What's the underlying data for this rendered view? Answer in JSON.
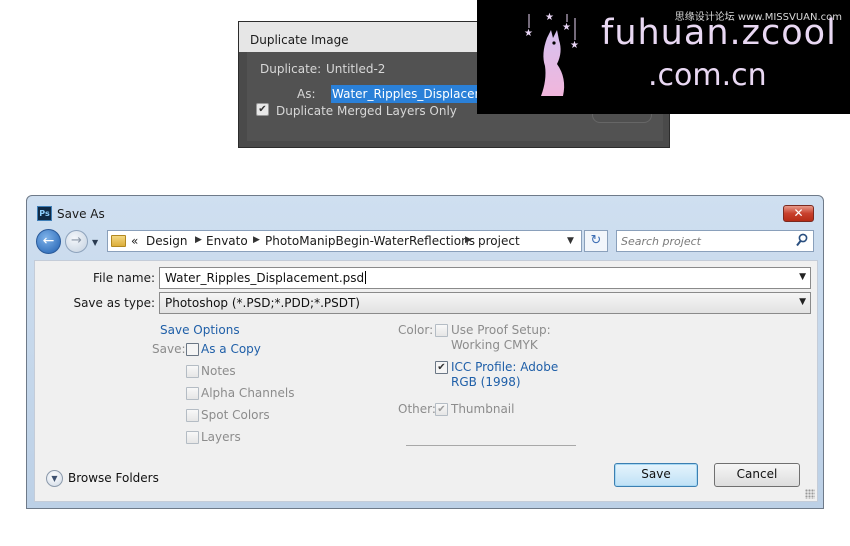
{
  "duplicate_dialog": {
    "title": "Duplicate Image",
    "duplicate_label": "Duplicate:",
    "duplicate_value": "Untitled-2",
    "as_label": "As:",
    "as_value": "Water_Ripples_Displacement",
    "merged_checkbox_label": "Duplicate Merged Layers Only",
    "merged_checked": true
  },
  "watermark": {
    "tag": "思缘设计论坛 www.MISSVUAN.com",
    "line1": "fuhuan.zcool",
    "line2": ".com.cn"
  },
  "save_as": {
    "title": "Save As",
    "app_icon_label": "Ps",
    "close_glyph": "✕",
    "breadcrumb": [
      "«",
      "Design",
      "Envato",
      "PhotoManipBegin-WaterReflections",
      "project"
    ],
    "search_placeholder": "Search project",
    "file_name_label": "File name:",
    "file_name_value": "Water_Ripples_Displacement.psd",
    "save_type_label": "Save as type:",
    "save_type_value": "Photoshop (*.PSD;*.PDD;*.PSDT)",
    "save_options_heading": "Save Options",
    "save_label": "Save:",
    "save_checkboxes": [
      {
        "label": "As a Copy",
        "checked": false,
        "enabled": true
      },
      {
        "label": "Notes",
        "checked": false,
        "enabled": false
      },
      {
        "label": "Alpha Channels",
        "checked": false,
        "enabled": false
      },
      {
        "label": "Spot Colors",
        "checked": false,
        "enabled": false
      },
      {
        "label": "Layers",
        "checked": false,
        "enabled": false
      }
    ],
    "color_label": "Color:",
    "proof_line1": "Use Proof Setup:",
    "proof_line2": "Working CMYK",
    "icc_line1": "ICC Profile:  Adobe",
    "icc_line2": "RGB (1998)",
    "icc_checked": true,
    "other_label": "Other:",
    "thumbnail_label": "Thumbnail",
    "thumbnail_checked": true,
    "browse_folders": "Browse Folders",
    "save_button": "Save",
    "cancel_button": "Cancel"
  },
  "colors": {
    "accent": "#1f5fa8",
    "selection": "#2a80d8",
    "close_red": "#c8402d"
  }
}
